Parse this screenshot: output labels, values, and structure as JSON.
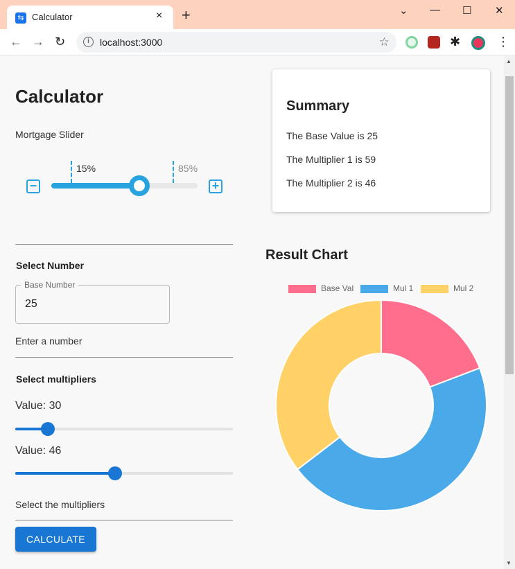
{
  "browser": {
    "tab_title": "Calculator",
    "tab_close": "×",
    "new_tab": "+",
    "url": "localhost:3000",
    "window_controls": [
      "⌄",
      "—",
      "☐",
      "✕"
    ]
  },
  "page": {
    "title": "Calculator",
    "mortgage_slider": {
      "label": "Mortgage Slider",
      "marker_low_label": "15%",
      "marker_high_label": "85%",
      "value_fraction": 0.6
    },
    "select_number": {
      "heading": "Select Number",
      "field_label": "Base Number",
      "field_value": "25",
      "helper_text": "Enter a number"
    },
    "select_multipliers": {
      "heading": "Select multipliers",
      "sliders": [
        {
          "label": "Value: 30",
          "value_fraction": 0.15
        },
        {
          "label": "Value: 46",
          "value_fraction": 0.46
        }
      ],
      "helper_text": "Select the multipliers"
    },
    "calculate_button": "CALCULATE"
  },
  "summary": {
    "title": "Summary",
    "lines": [
      "The Base Value is 25",
      "The Multiplier 1 is 59",
      "The Multiplier 2 is 46"
    ]
  },
  "chart": {
    "title": "Result Chart"
  },
  "chart_data": {
    "type": "pie",
    "title": "Result Chart",
    "categories": [
      "Base Val",
      "Mul 1",
      "Mul 2"
    ],
    "values": [
      25,
      59,
      46
    ],
    "colors": [
      "#ff6f8d",
      "#4aa9e9",
      "#ffd166"
    ],
    "legend_position": "top"
  }
}
